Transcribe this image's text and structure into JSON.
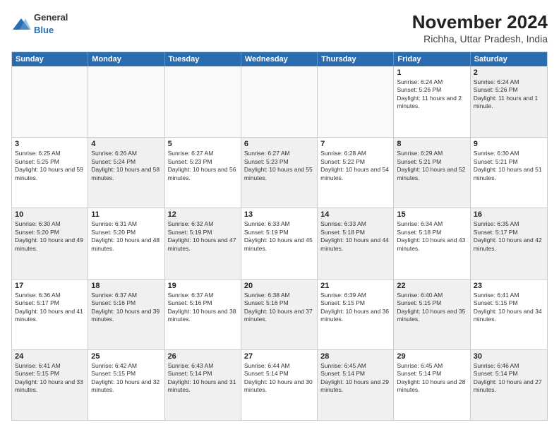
{
  "logo": {
    "general": "General",
    "blue": "Blue"
  },
  "title": "November 2024",
  "subtitle": "Richha, Uttar Pradesh, India",
  "header_days": [
    "Sunday",
    "Monday",
    "Tuesday",
    "Wednesday",
    "Thursday",
    "Friday",
    "Saturday"
  ],
  "weeks": [
    [
      {
        "day": "",
        "text": "",
        "shaded": false,
        "empty": true
      },
      {
        "day": "",
        "text": "",
        "shaded": false,
        "empty": true
      },
      {
        "day": "",
        "text": "",
        "shaded": false,
        "empty": true
      },
      {
        "day": "",
        "text": "",
        "shaded": false,
        "empty": true
      },
      {
        "day": "",
        "text": "",
        "shaded": false,
        "empty": true
      },
      {
        "day": "1",
        "text": "Sunrise: 6:24 AM\nSunset: 5:26 PM\nDaylight: 11 hours and 2 minutes.",
        "shaded": false,
        "empty": false
      },
      {
        "day": "2",
        "text": "Sunrise: 6:24 AM\nSunset: 5:26 PM\nDaylight: 11 hours and 1 minute.",
        "shaded": true,
        "empty": false
      }
    ],
    [
      {
        "day": "3",
        "text": "Sunrise: 6:25 AM\nSunset: 5:25 PM\nDaylight: 10 hours and 59 minutes.",
        "shaded": false,
        "empty": false
      },
      {
        "day": "4",
        "text": "Sunrise: 6:26 AM\nSunset: 5:24 PM\nDaylight: 10 hours and 58 minutes.",
        "shaded": true,
        "empty": false
      },
      {
        "day": "5",
        "text": "Sunrise: 6:27 AM\nSunset: 5:23 PM\nDaylight: 10 hours and 56 minutes.",
        "shaded": false,
        "empty": false
      },
      {
        "day": "6",
        "text": "Sunrise: 6:27 AM\nSunset: 5:23 PM\nDaylight: 10 hours and 55 minutes.",
        "shaded": true,
        "empty": false
      },
      {
        "day": "7",
        "text": "Sunrise: 6:28 AM\nSunset: 5:22 PM\nDaylight: 10 hours and 54 minutes.",
        "shaded": false,
        "empty": false
      },
      {
        "day": "8",
        "text": "Sunrise: 6:29 AM\nSunset: 5:21 PM\nDaylight: 10 hours and 52 minutes.",
        "shaded": true,
        "empty": false
      },
      {
        "day": "9",
        "text": "Sunrise: 6:30 AM\nSunset: 5:21 PM\nDaylight: 10 hours and 51 minutes.",
        "shaded": false,
        "empty": false
      }
    ],
    [
      {
        "day": "10",
        "text": "Sunrise: 6:30 AM\nSunset: 5:20 PM\nDaylight: 10 hours and 49 minutes.",
        "shaded": true,
        "empty": false
      },
      {
        "day": "11",
        "text": "Sunrise: 6:31 AM\nSunset: 5:20 PM\nDaylight: 10 hours and 48 minutes.",
        "shaded": false,
        "empty": false
      },
      {
        "day": "12",
        "text": "Sunrise: 6:32 AM\nSunset: 5:19 PM\nDaylight: 10 hours and 47 minutes.",
        "shaded": true,
        "empty": false
      },
      {
        "day": "13",
        "text": "Sunrise: 6:33 AM\nSunset: 5:19 PM\nDaylight: 10 hours and 45 minutes.",
        "shaded": false,
        "empty": false
      },
      {
        "day": "14",
        "text": "Sunrise: 6:33 AM\nSunset: 5:18 PM\nDaylight: 10 hours and 44 minutes.",
        "shaded": true,
        "empty": false
      },
      {
        "day": "15",
        "text": "Sunrise: 6:34 AM\nSunset: 5:18 PM\nDaylight: 10 hours and 43 minutes.",
        "shaded": false,
        "empty": false
      },
      {
        "day": "16",
        "text": "Sunrise: 6:35 AM\nSunset: 5:17 PM\nDaylight: 10 hours and 42 minutes.",
        "shaded": true,
        "empty": false
      }
    ],
    [
      {
        "day": "17",
        "text": "Sunrise: 6:36 AM\nSunset: 5:17 PM\nDaylight: 10 hours and 41 minutes.",
        "shaded": false,
        "empty": false
      },
      {
        "day": "18",
        "text": "Sunrise: 6:37 AM\nSunset: 5:16 PM\nDaylight: 10 hours and 39 minutes.",
        "shaded": true,
        "empty": false
      },
      {
        "day": "19",
        "text": "Sunrise: 6:37 AM\nSunset: 5:16 PM\nDaylight: 10 hours and 38 minutes.",
        "shaded": false,
        "empty": false
      },
      {
        "day": "20",
        "text": "Sunrise: 6:38 AM\nSunset: 5:16 PM\nDaylight: 10 hours and 37 minutes.",
        "shaded": true,
        "empty": false
      },
      {
        "day": "21",
        "text": "Sunrise: 6:39 AM\nSunset: 5:15 PM\nDaylight: 10 hours and 36 minutes.",
        "shaded": false,
        "empty": false
      },
      {
        "day": "22",
        "text": "Sunrise: 6:40 AM\nSunset: 5:15 PM\nDaylight: 10 hours and 35 minutes.",
        "shaded": true,
        "empty": false
      },
      {
        "day": "23",
        "text": "Sunrise: 6:41 AM\nSunset: 5:15 PM\nDaylight: 10 hours and 34 minutes.",
        "shaded": false,
        "empty": false
      }
    ],
    [
      {
        "day": "24",
        "text": "Sunrise: 6:41 AM\nSunset: 5:15 PM\nDaylight: 10 hours and 33 minutes.",
        "shaded": true,
        "empty": false
      },
      {
        "day": "25",
        "text": "Sunrise: 6:42 AM\nSunset: 5:15 PM\nDaylight: 10 hours and 32 minutes.",
        "shaded": false,
        "empty": false
      },
      {
        "day": "26",
        "text": "Sunrise: 6:43 AM\nSunset: 5:14 PM\nDaylight: 10 hours and 31 minutes.",
        "shaded": true,
        "empty": false
      },
      {
        "day": "27",
        "text": "Sunrise: 6:44 AM\nSunset: 5:14 PM\nDaylight: 10 hours and 30 minutes.",
        "shaded": false,
        "empty": false
      },
      {
        "day": "28",
        "text": "Sunrise: 6:45 AM\nSunset: 5:14 PM\nDaylight: 10 hours and 29 minutes.",
        "shaded": true,
        "empty": false
      },
      {
        "day": "29",
        "text": "Sunrise: 6:45 AM\nSunset: 5:14 PM\nDaylight: 10 hours and 28 minutes.",
        "shaded": false,
        "empty": false
      },
      {
        "day": "30",
        "text": "Sunrise: 6:46 AM\nSunset: 5:14 PM\nDaylight: 10 hours and 27 minutes.",
        "shaded": true,
        "empty": false
      }
    ]
  ]
}
